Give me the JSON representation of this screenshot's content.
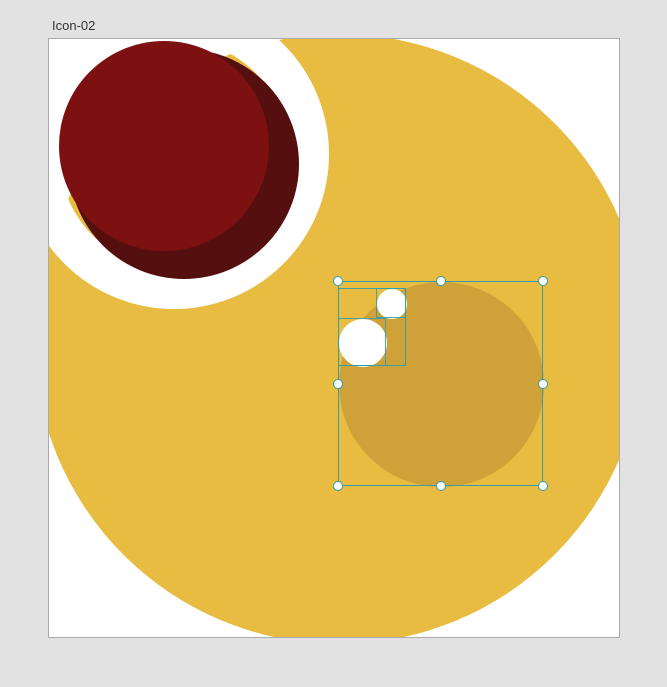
{
  "artboard": {
    "label": "Icon-02"
  },
  "shapes": {
    "big_circle": {
      "fill": "#e8bb41"
    },
    "red_shadow": {
      "fill": "#560f0f"
    },
    "red_front": {
      "fill": "#7d1010"
    },
    "white_ring": {
      "stroke": "#ffffff"
    },
    "mustard_circle": {
      "fill": "#cfa239"
    },
    "small_white_1": {
      "fill": "#ffffff"
    },
    "small_white_2": {
      "fill": "#ffffff"
    }
  },
  "selection": {
    "active": true,
    "color": "#2f9fb0"
  }
}
